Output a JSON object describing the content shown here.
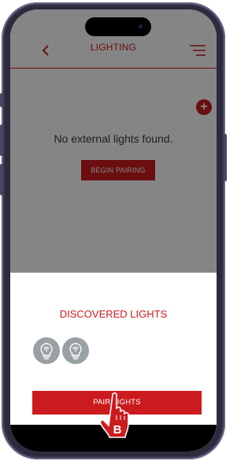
{
  "header": {
    "title": "LIGHTING"
  },
  "main": {
    "empty_message": "No external lights found.",
    "begin_pairing_label": "BEGIN PAIRING",
    "add_label": "+"
  },
  "sheet": {
    "title": "DISCOVERED LIGHTS",
    "discovered_count": 2,
    "pair_button_label": "PAIR LIGHTS"
  },
  "cursor": {
    "badge_label": "B"
  },
  "colors": {
    "accent": "#cc1b1f",
    "bulb_bg": "#9aa1a5"
  },
  "icons": {
    "back": "chevron-left-icon",
    "menu": "hamburger-menu-icon",
    "add": "plus-circle-icon",
    "bulb": "lightbulb-wifi-icon",
    "pointer": "hand-pointer-icon"
  }
}
